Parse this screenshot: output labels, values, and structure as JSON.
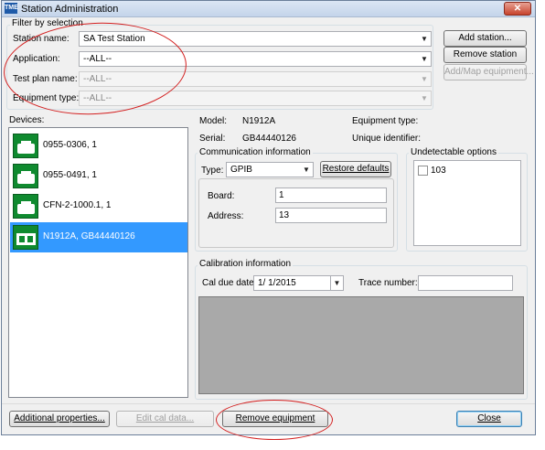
{
  "window": {
    "title": "Station Administration",
    "app_icon_text": "TME",
    "close_glyph": "✕"
  },
  "filter": {
    "legend": "Filter by selection",
    "station_name_label": "Station name:",
    "station_name_value": "SA Test Station",
    "application_label": "Application:",
    "application_value": "--ALL--",
    "test_plan_label": "Test plan name:",
    "test_plan_value": "--ALL--",
    "equipment_type_label": "Equipment type:",
    "equipment_type_value": "--ALL--"
  },
  "station_buttons": {
    "add_station": "Add station...",
    "remove_station": "Remove station",
    "add_map_equipment": "Add/Map equipment..."
  },
  "devices": {
    "label": "Devices:",
    "items": [
      {
        "label": "0955-0306, 1",
        "selected": false
      },
      {
        "label": "0955-0491, 1",
        "selected": false
      },
      {
        "label": "CFN-2-1000.1, 1",
        "selected": false
      },
      {
        "label": "N1912A, GB44440126",
        "selected": true
      }
    ]
  },
  "details": {
    "model_label": "Model:",
    "model_value": "N1912A",
    "serial_label": "Serial:",
    "serial_value": "GB44440126",
    "equipment_type_label": "Equipment type:",
    "equipment_type_value": "",
    "unique_identifier_label": "Unique identifier:",
    "unique_identifier_value": ""
  },
  "communication": {
    "legend": "Communication information",
    "type_label": "Type:",
    "type_value": "GPIB",
    "restore_defaults": "Restore defaults",
    "board_label": "Board:",
    "board_value": "1",
    "address_label": "Address:",
    "address_value": "13"
  },
  "undetectable": {
    "legend": "Undetectable options",
    "options": [
      {
        "label": "103",
        "checked": false
      }
    ]
  },
  "calibration": {
    "legend": "Calibration information",
    "cal_due_label": "Cal due date:",
    "cal_due_value": "1/  1/2015",
    "trace_number_label": "Trace number:",
    "trace_number_value": ""
  },
  "bottom_buttons": {
    "additional_properties": "Additional properties...",
    "edit_cal_data": "Edit cal data...",
    "remove_equipment": "Remove equipment",
    "close": "Close"
  },
  "annotation_color": "#d31f1f",
  "selection_color": "#3399ff",
  "device_icon_color": "#0f8a2f"
}
